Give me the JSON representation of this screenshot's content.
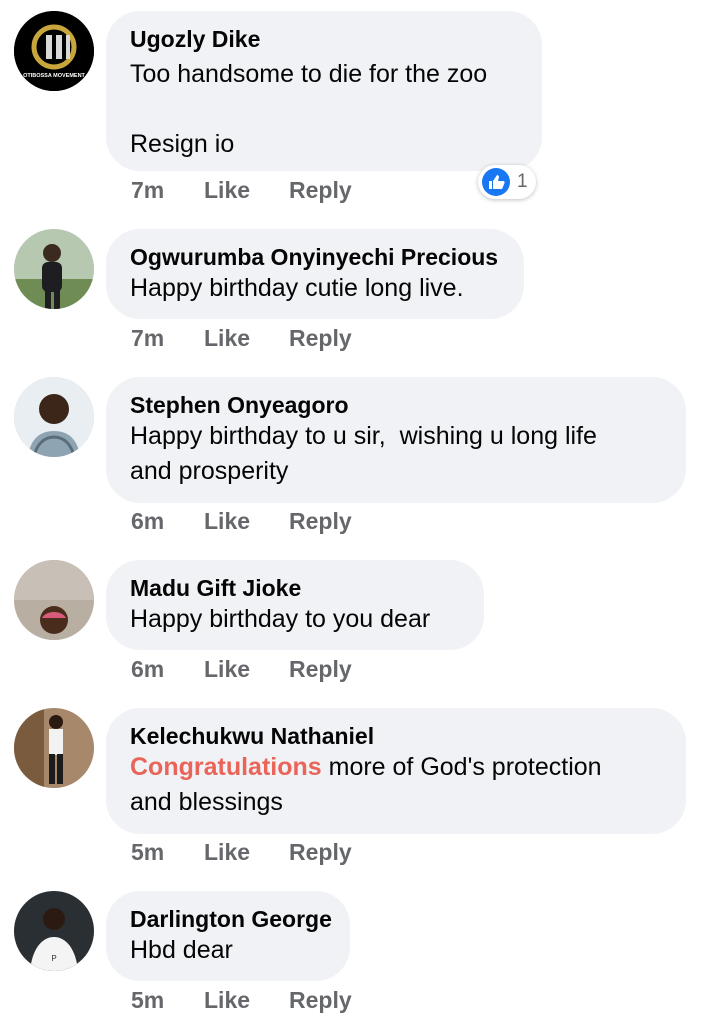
{
  "comments": [
    {
      "author": "Ugozly Dike",
      "text": "Too handsome to die for the zoo\n\nResign io",
      "time": "7m",
      "like_label": "Like",
      "reply_label": "Reply",
      "reaction": {
        "icon": "like-reaction-icon",
        "count": "1"
      },
      "avatar_logo_text": "OTIBOSSA MOVEMENT"
    },
    {
      "author": "Ogwurumba Onyinyechi Precious",
      "text": "Happy birthday cutie long live.",
      "time": "7m",
      "like_label": "Like",
      "reply_label": "Reply"
    },
    {
      "author": "Stephen Onyeagoro",
      "text": "Happy birthday to u sir,  wishing u long life\nand prosperity",
      "time": "6m",
      "like_label": "Like",
      "reply_label": "Reply"
    },
    {
      "author": "Madu Gift Jioke",
      "text": "Happy birthday to you dear",
      "time": "6m",
      "like_label": "Like",
      "reply_label": "Reply"
    },
    {
      "author": "Kelechukwu Nathaniel",
      "highlight": "Congratulations",
      "text": " more of God's protection\nand blessings",
      "time": "5m",
      "like_label": "Like",
      "reply_label": "Reply"
    },
    {
      "author": "Darlington George",
      "text": "Hbd dear",
      "time": "5m",
      "like_label": "Like",
      "reply_label": "Reply"
    }
  ],
  "colors": {
    "bubble": "#f0f2f5",
    "meta": "#65676b",
    "highlight": "#e9655a",
    "like_blue": "#1877f2"
  }
}
